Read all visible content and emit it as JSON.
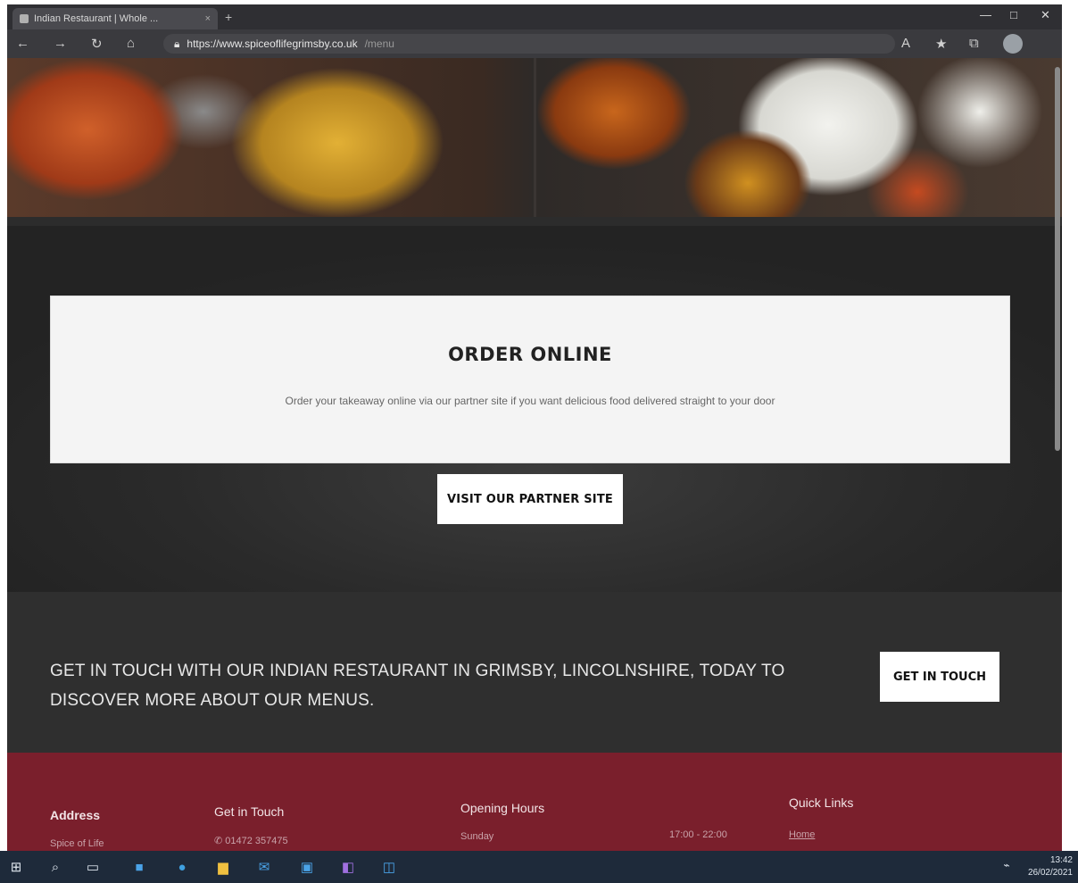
{
  "browser": {
    "tab_title": "Indian Restaurant | Whole ...",
    "tab_close": "×",
    "new_tab": "+",
    "url_main": "https://www.spiceoflifegrimsby.co.uk",
    "url_rest": "/menu",
    "window_controls": [
      "—",
      "□",
      "✕"
    ]
  },
  "order": {
    "title": "ORDER ONLINE",
    "text": "Order your takeaway online via our partner site if you want delicious food delivered straight to your door",
    "button_label": "VISIT OUR PARTNER SITE"
  },
  "touch": {
    "text": "GET IN TOUCH WITH OUR INDIAN RESTAURANT IN GRIMSBY, LINCOLNSHIRE, TODAY TO DISCOVER MORE ABOUT OUR MENUS.",
    "button_label": "GET IN TOUCH"
  },
  "footer": {
    "address": {
      "heading": "Address",
      "value": "Spice of Life"
    },
    "contact": {
      "heading": "Get in Touch",
      "value": "01472 357475"
    },
    "hours": {
      "heading": "Opening Hours",
      "day": "Sunday",
      "time": "17:00 - 22:00"
    },
    "links": {
      "heading": "Quick Links",
      "value": "Home"
    }
  },
  "taskbar": {
    "time": "13:42",
    "date": "26/02/2021"
  },
  "icons": [
    "back-icon",
    "forward-icon",
    "refresh-icon",
    "home-icon",
    "lock-icon",
    "favorites-icon",
    "collections-icon",
    "profile-icon",
    "windows-start-icon",
    "search-icon",
    "task-view-icon",
    "edge-icon",
    "file-explorer-icon",
    "mail-icon",
    "store-icon",
    "app-icon"
  ]
}
